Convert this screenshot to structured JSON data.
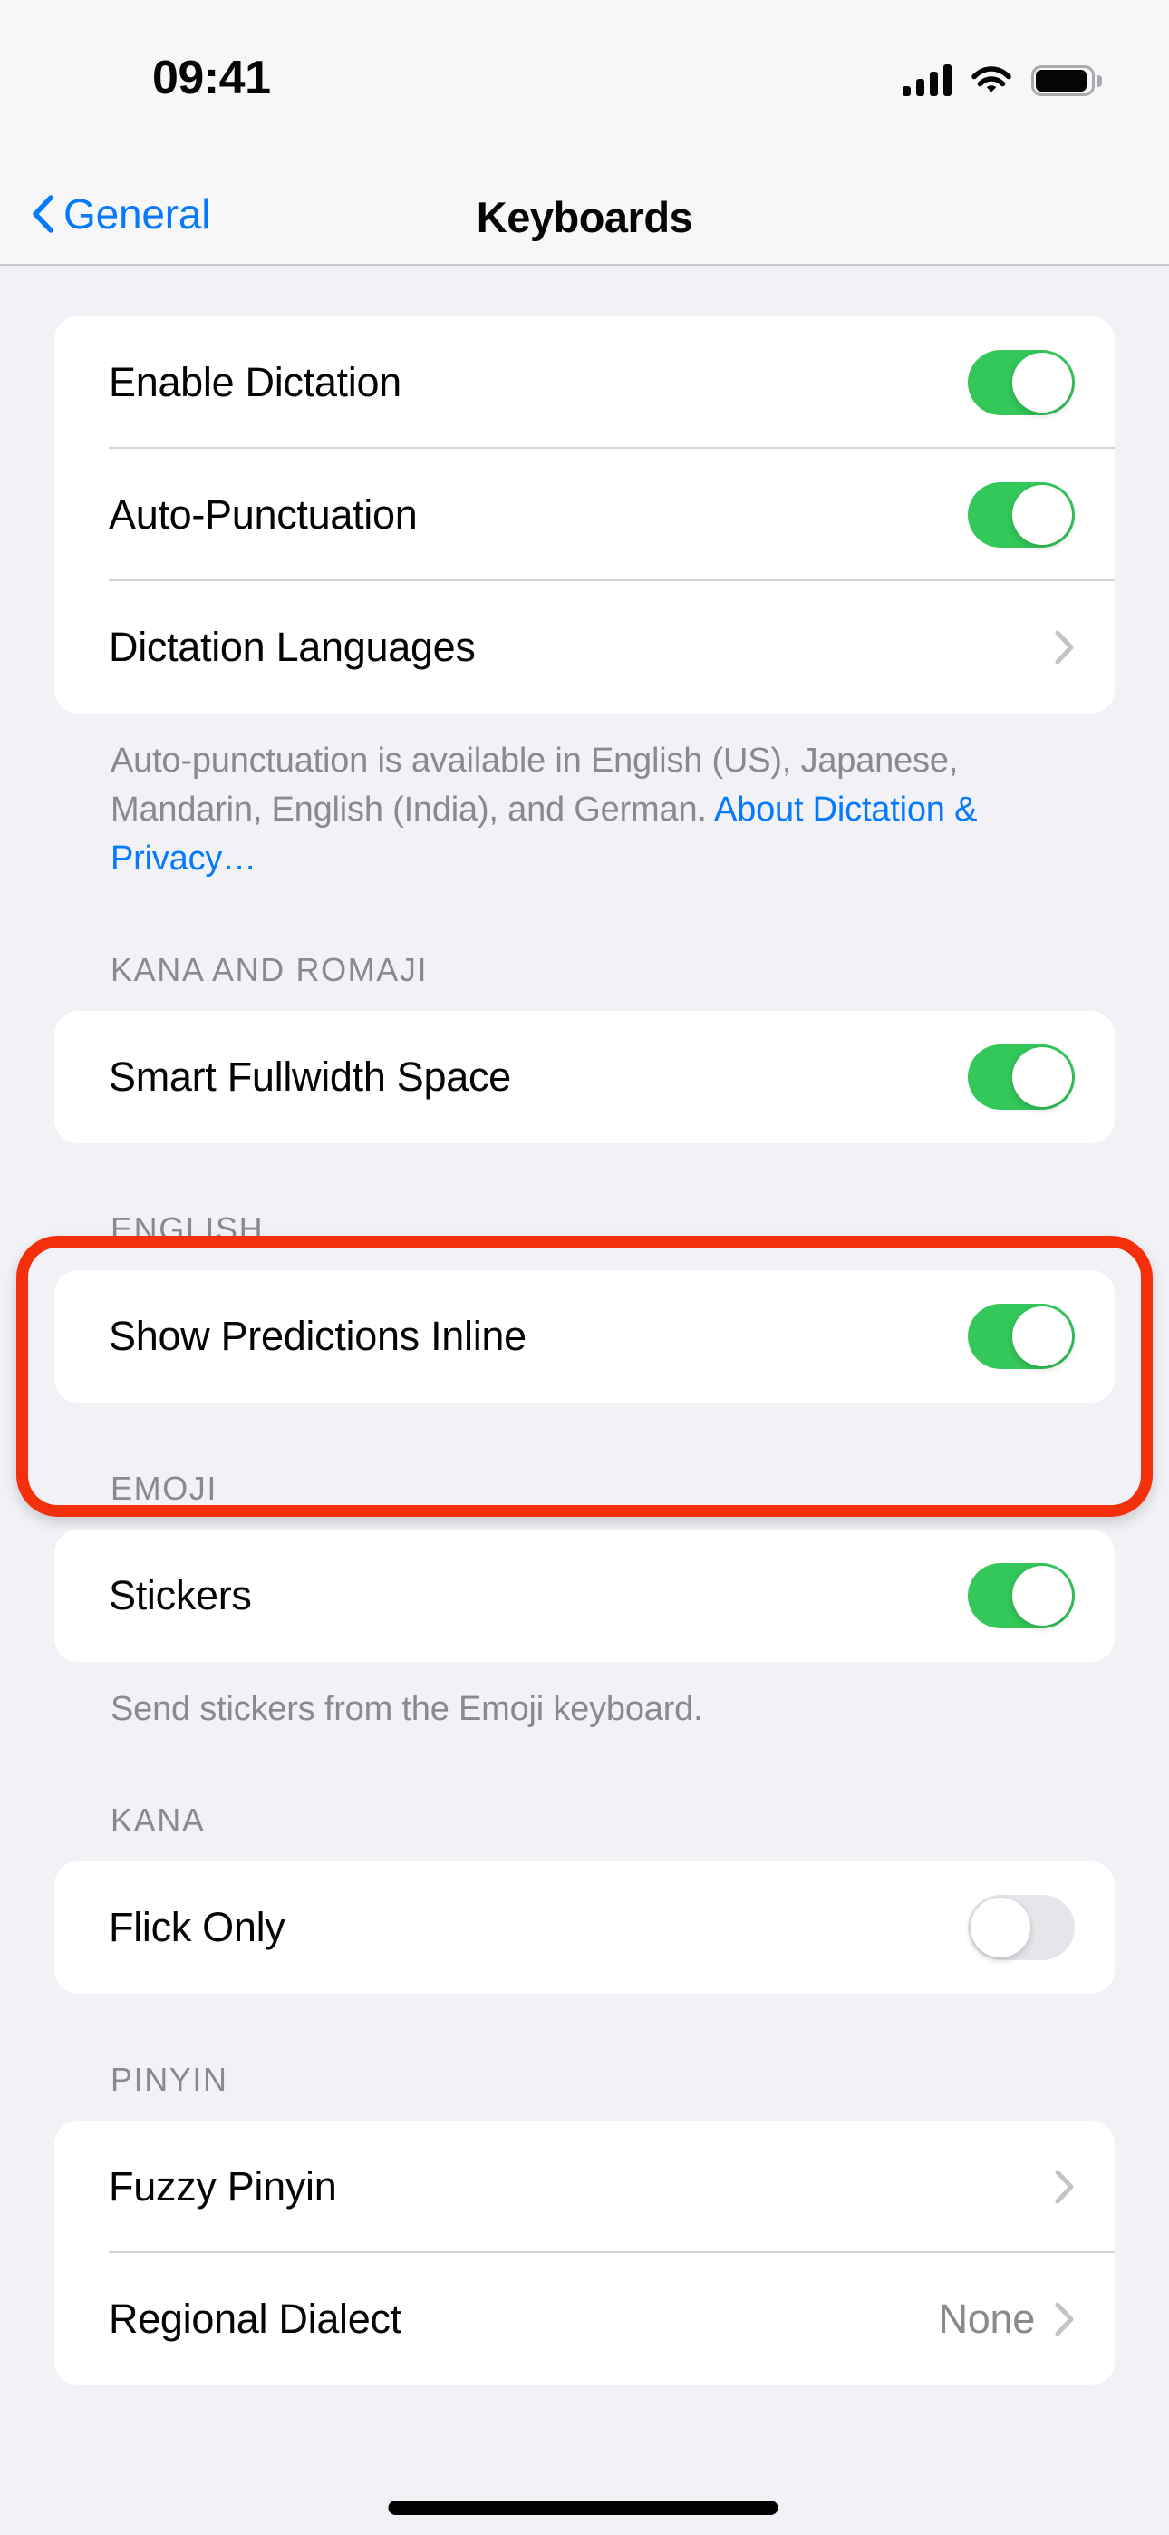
{
  "status_bar": {
    "time": "09:41",
    "cellular_icon": "cellular-bars-icon",
    "cellular_bars": 4,
    "wifi_icon": "wifi-icon",
    "battery_icon": "battery-full-icon"
  },
  "nav": {
    "back_label": "General",
    "back_icon": "chevron-left-icon",
    "title": "Keyboards"
  },
  "colors": {
    "accent_blue": "#067AFB",
    "toggle_on_green": "#34C759",
    "toggle_off_gray": "#E6E6EA",
    "highlight_red": "#F4300C",
    "page_background": "#F1F1F6",
    "card_background": "#FFFFFF",
    "secondary_text": "#8A8A8E"
  },
  "sections": [
    {
      "id": "dictation",
      "header": "",
      "rows": [
        {
          "label": "Enable Dictation",
          "type": "toggle",
          "value": "on"
        },
        {
          "label": "Auto-Punctuation",
          "type": "toggle",
          "value": "on"
        },
        {
          "label": "Dictation Languages",
          "type": "disclosure",
          "value": ""
        }
      ],
      "footer_text": "Auto-punctuation is available in English (US), Japanese, Mandarin, English (India), and German. ",
      "footer_link": "About Dictation & Privacy…"
    },
    {
      "id": "kana-and-romaji",
      "header": "KANA AND ROMAJI",
      "rows": [
        {
          "label": "Smart Fullwidth Space",
          "type": "toggle",
          "value": "on"
        }
      ]
    },
    {
      "id": "english",
      "header": "ENGLISH",
      "rows": [
        {
          "label": "Show Predictions Inline",
          "type": "toggle",
          "value": "on"
        }
      ]
    },
    {
      "id": "emoji",
      "header": "EMOJI",
      "rows": [
        {
          "label": "Stickers",
          "type": "toggle",
          "value": "on"
        }
      ],
      "footer_text": "Send stickers from the Emoji keyboard."
    },
    {
      "id": "kana",
      "header": "KANA",
      "rows": [
        {
          "label": "Flick Only",
          "type": "toggle",
          "value": "off"
        }
      ]
    },
    {
      "id": "pinyin",
      "header": "PINYIN",
      "rows": [
        {
          "label": "Fuzzy Pinyin",
          "type": "disclosure",
          "value": ""
        },
        {
          "label": "Regional Dialect",
          "type": "disclosure",
          "value": "None"
        }
      ]
    }
  ],
  "annotation": {
    "highlight_target": "english-section",
    "shape": "rounded-rectangle",
    "color": "#F4300C"
  },
  "home_indicator": "home-indicator"
}
